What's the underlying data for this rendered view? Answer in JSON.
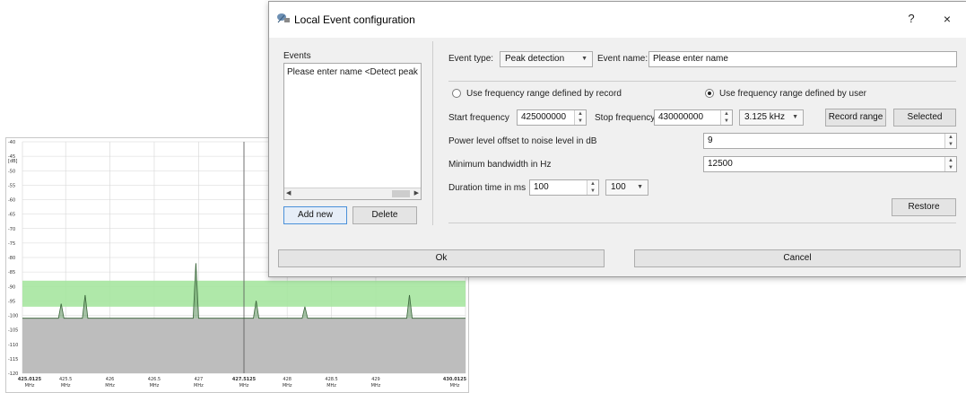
{
  "dialog": {
    "title": "Local Event configuration",
    "help_label": "?",
    "close_label": "×"
  },
  "events_panel": {
    "label": "Events",
    "items": [
      "Please enter name <Detect peak"
    ],
    "add_new_label": "Add new",
    "delete_label": "Delete"
  },
  "form": {
    "event_type_label": "Event type:",
    "event_type_value": "Peak detection",
    "event_name_label": "Event name:",
    "event_name_value": "Please enter name",
    "radio_record_label": "Use frequency range defined by record",
    "radio_user_label": "Use frequency range defined by user",
    "radio_selected": "user",
    "start_freq_label": "Start frequency",
    "start_freq_value": "425000000",
    "stop_freq_label": "Stop frequency",
    "stop_freq_value": "430000000",
    "step_value": "3.125 kHz",
    "record_range_label": "Record range",
    "selected_label": "Selected",
    "power_offset_label": "Power level offset to noise level in dB",
    "power_offset_value": "9",
    "min_bw_label": "Minimum bandwidth in Hz",
    "min_bw_value": "12500",
    "duration_label": "Duration time in ms",
    "duration_value": "100",
    "duration_combo_value": "100",
    "restore_label": "Restore"
  },
  "footer": {
    "ok_label": "Ok",
    "cancel_label": "Cancel"
  },
  "spectrum": {
    "y_ticks": [
      "-40",
      "-45",
      "-50",
      "-55",
      "-60",
      "-65",
      "-70",
      "-75",
      "-80",
      "-85",
      "-90",
      "-95",
      "-100",
      "-105",
      "-110",
      "-115",
      "-120"
    ],
    "y_unit": "[dB]",
    "x_ticks": [
      {
        "l1": "425.0125",
        "l2": "MHz",
        "bold": true
      },
      {
        "l1": "425.5",
        "l2": "MHz"
      },
      {
        "l1": "426",
        "l2": "MHz"
      },
      {
        "l1": "426.5",
        "l2": "MHz"
      },
      {
        "l1": "427",
        "l2": "MHz"
      },
      {
        "l1": "427.5125",
        "l2": "MHz",
        "bold": true
      },
      {
        "l1": "428",
        "l2": "MHz"
      },
      {
        "l1": "428.5",
        "l2": "MHz"
      },
      {
        "l1": "429",
        "l2": "MHz"
      },
      {
        "l1": "430.0125",
        "l2": "MHz",
        "bold": true
      }
    ],
    "y_range": [
      -120,
      -40
    ],
    "x_range": [
      425.0125,
      430.0125
    ],
    "noise_floor_db": -101,
    "band_db": [
      -97,
      -88
    ],
    "peaks": [
      {
        "x": 425.45,
        "y": -96
      },
      {
        "x": 425.72,
        "y": -93
      },
      {
        "x": 426.97,
        "y": -82
      },
      {
        "x": 427.65,
        "y": -95
      },
      {
        "x": 428.2,
        "y": -97
      },
      {
        "x": 429.38,
        "y": -93
      }
    ],
    "colors": {
      "band": "#a6e6a0",
      "noise": "#bdbdbd",
      "trace": "#2f5a2f",
      "grid": "#d6d6d6"
    }
  }
}
